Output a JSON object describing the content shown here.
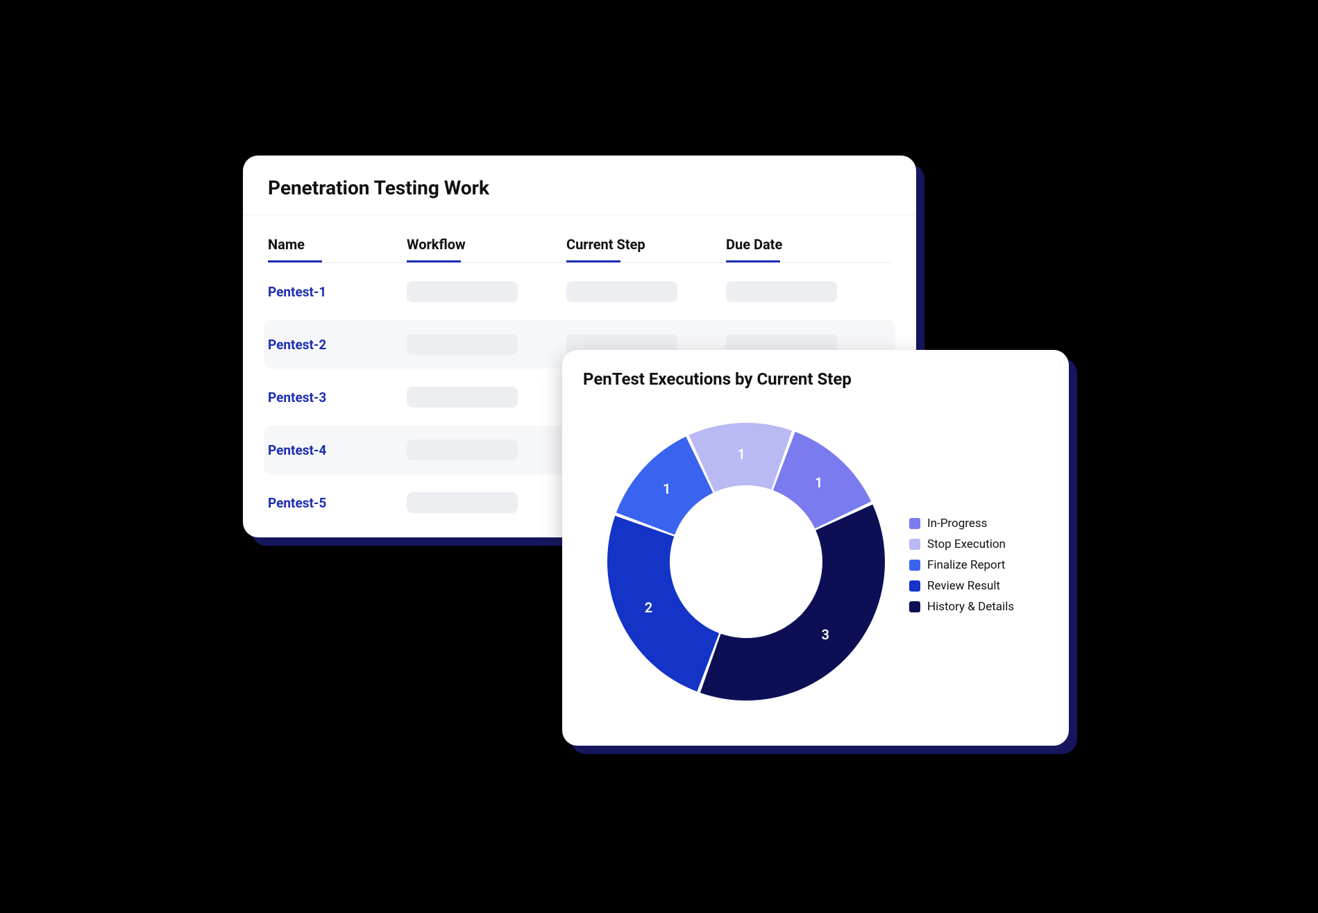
{
  "table_card": {
    "title": "Penetration Testing Work",
    "columns": {
      "c0": "Name",
      "c1": "Workflow",
      "c2": "Current Step",
      "c3": "Due Date"
    },
    "rows": [
      {
        "name": "Pentest-1"
      },
      {
        "name": "Pentest-2"
      },
      {
        "name": "Pentest-3"
      },
      {
        "name": "Pentest-4"
      },
      {
        "name": "Pentest-5"
      }
    ]
  },
  "chart_card": {
    "title": "PenTest Executions by Current Step"
  },
  "legend": {
    "l0": "In-Progress",
    "l1": "Stop Execution",
    "l2": "Finalize Report",
    "l3": "Review Result",
    "l4": "History & Details"
  },
  "colors": {
    "in_progress": "#7b7bf0",
    "stop_execution": "#b9b9f4",
    "finalize_report": "#3a63ef",
    "review_result": "#1433c7",
    "history_details": "#0d0f55"
  },
  "chart_data": {
    "type": "pie",
    "title": "PenTest Executions by Current Step",
    "series": [
      {
        "name": "In-Progress",
        "value": 1,
        "label": "1",
        "color": "#7b7bf0"
      },
      {
        "name": "Stop Execution",
        "value": 1,
        "label": "1",
        "color": "#b9b9f4"
      },
      {
        "name": "Finalize Report",
        "value": 1,
        "label": "1",
        "color": "#3a63ef"
      },
      {
        "name": "Review Result",
        "value": 2,
        "label": "2",
        "color": "#1433c7"
      },
      {
        "name": "History & Details",
        "value": 3,
        "label": "3",
        "color": "#0d0f55"
      }
    ],
    "donut": true,
    "inner_radius_ratio": 0.55,
    "start_angle_deg": -25
  }
}
